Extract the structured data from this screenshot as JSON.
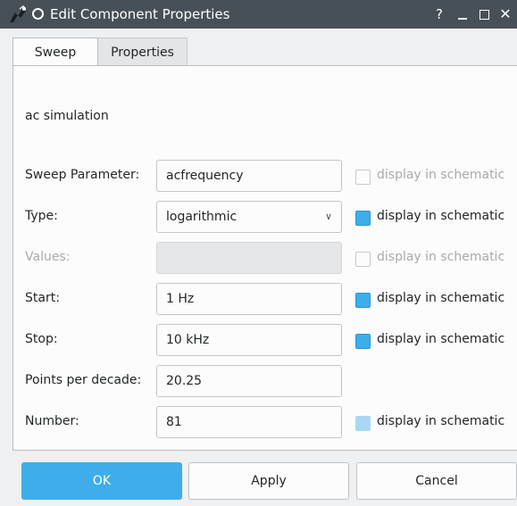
{
  "window": {
    "title": "Edit Component Properties",
    "help": "?",
    "close": "✕"
  },
  "tabs": [
    {
      "label": "Sweep"
    },
    {
      "label": "Properties"
    }
  ],
  "simulation_label": "ac simulation",
  "rows": [
    {
      "label": "Sweep Parameter:",
      "value": "acfrequency",
      "checkbox_label": "display in schematic"
    },
    {
      "label": "Type:",
      "value": "logarithmic",
      "checkbox_label": "display in schematic"
    },
    {
      "label": "Values:",
      "value": "",
      "checkbox_label": "display in schematic"
    },
    {
      "label": "Start:",
      "value": "1 Hz",
      "checkbox_label": "display in schematic"
    },
    {
      "label": "Stop:",
      "value": "10 kHz",
      "checkbox_label": "display in schematic"
    },
    {
      "label": "Points per decade:",
      "value": "20.25"
    },
    {
      "label": "Number:",
      "value": "81",
      "checkbox_label": "display in schematic"
    }
  ],
  "buttons": {
    "ok": "OK",
    "apply": "Apply",
    "cancel": "Cancel"
  },
  "icons": {
    "app": "qucs-app-icon",
    "window_menu": "circle-icon",
    "dropdown": "chevron-down-icon"
  },
  "colors": {
    "titlebar": "#475057",
    "accent": "#3daee9",
    "background": "#eff0f1"
  }
}
